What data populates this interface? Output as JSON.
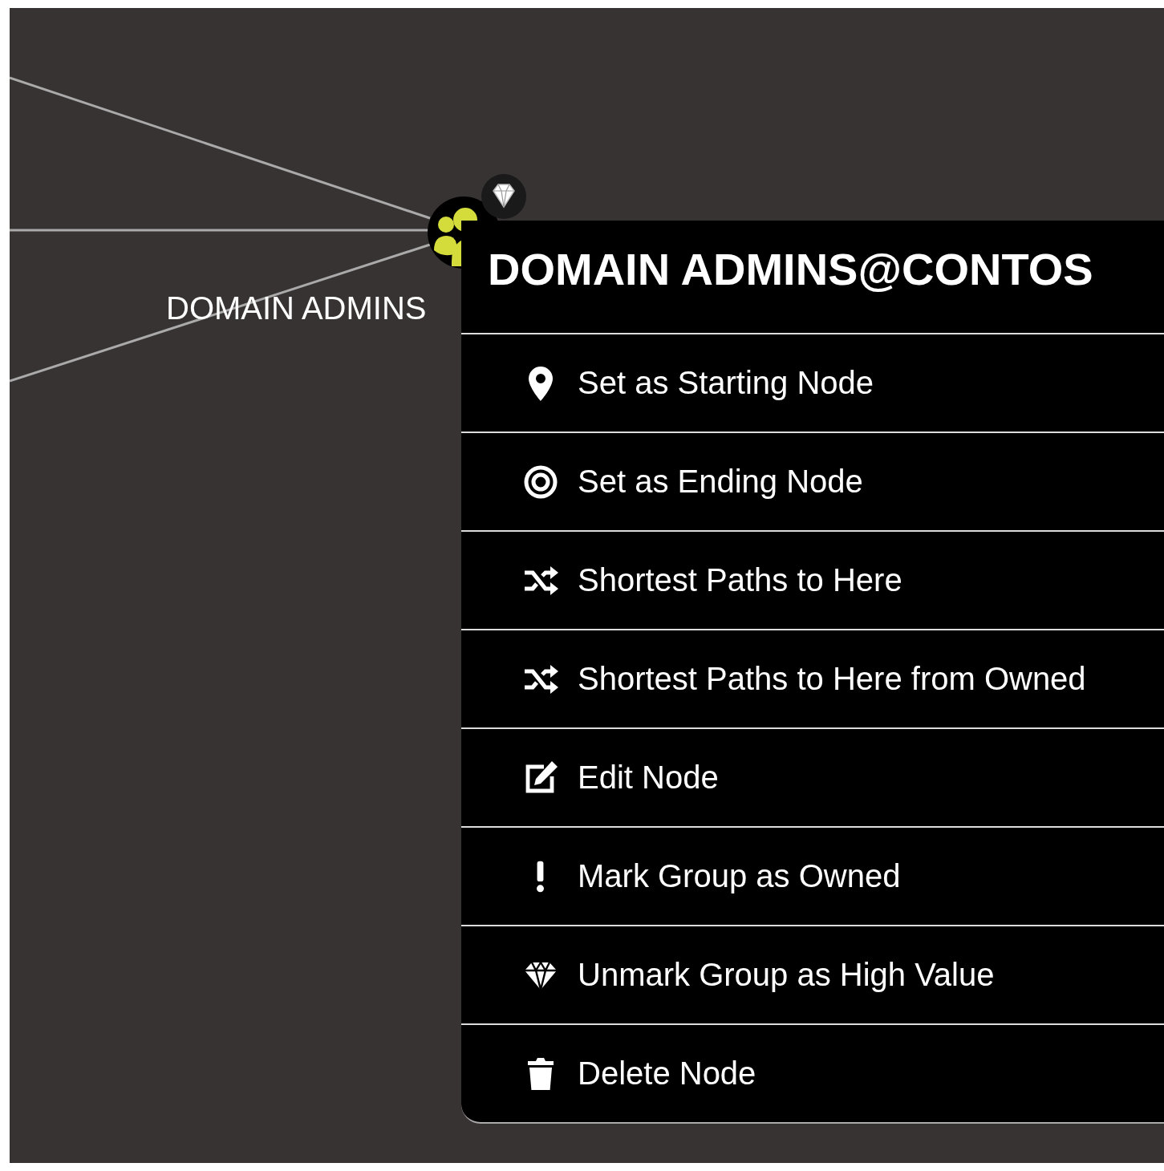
{
  "graph": {
    "node": {
      "label": "DOMAIN ADMINS",
      "high_value": true
    }
  },
  "context_menu": {
    "title": "DOMAIN ADMINS@CONTOS",
    "items": [
      "Set as Starting Node",
      "Set as Ending Node",
      "Shortest Paths to Here",
      "Shortest Paths to Here from Owned",
      "Edit Node",
      "Mark Group as Owned",
      "Unmark Group as High Value",
      "Delete Node"
    ]
  }
}
